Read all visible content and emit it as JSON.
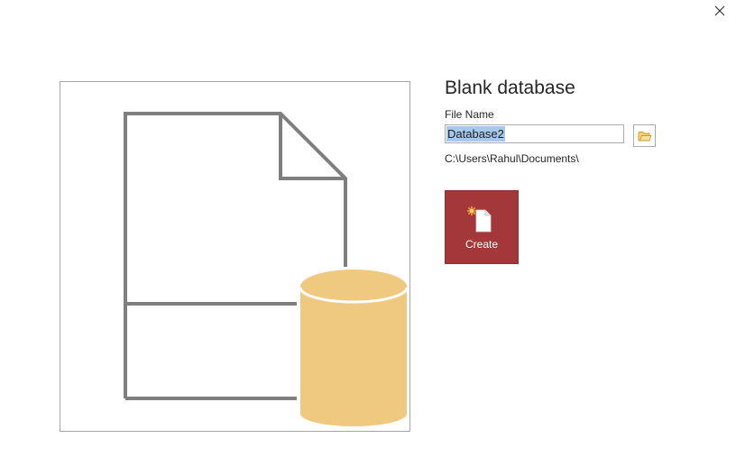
{
  "dialog": {
    "title": "Blank database",
    "file_name_label": "File Name",
    "file_name_value": "Database2",
    "path": "C:\\Users\\Rahul\\Documents\\",
    "create_label": "Create"
  },
  "icons": {
    "close": "close-icon",
    "browse": "folder-icon",
    "create": "new-database-icon",
    "preview": "blank-database-illustration"
  },
  "colors": {
    "accent": "#a4373a",
    "database": "#efc97f",
    "selection": "#a6c8ec"
  }
}
